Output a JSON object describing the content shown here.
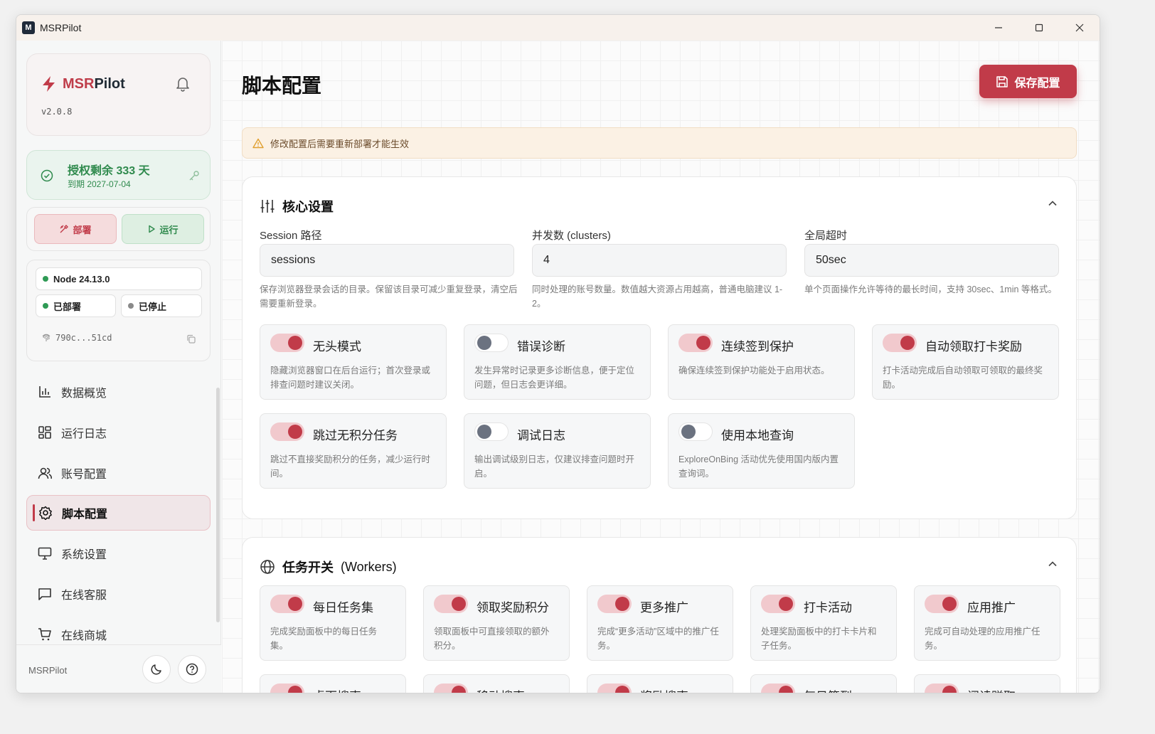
{
  "window": {
    "title": "MSRPilot"
  },
  "sidebar": {
    "brand": {
      "name_prefix": "MSR",
      "name_suffix": "Pilot",
      "version": "v2.0.8"
    },
    "license": {
      "title": "授权剩余 333 天",
      "expiry": "到期 2027-07-04"
    },
    "actions": {
      "deploy": "部署",
      "run": "运行"
    },
    "env": {
      "node": "Node 24.13.0",
      "deployed": "已部署",
      "stopped": "已停止",
      "hash": "790c...51cd"
    },
    "nav": [
      {
        "label": "数据概览",
        "icon": "bar-chart-icon"
      },
      {
        "label": "运行日志",
        "icon": "grid-icon"
      },
      {
        "label": "账号配置",
        "icon": "users-icon"
      },
      {
        "label": "脚本配置",
        "icon": "gear-icon",
        "active": true
      },
      {
        "label": "系统设置",
        "icon": "monitor-icon"
      },
      {
        "label": "在线客服",
        "icon": "chat-icon"
      },
      {
        "label": "在线商城",
        "icon": "cart-icon"
      }
    ],
    "footer": {
      "name": "MSRPilot"
    }
  },
  "main": {
    "title": "脚本配置",
    "save_label": "保存配置",
    "alert": "修改配置后需要重新部署才能生效",
    "core": {
      "title": "核心设置",
      "fields": [
        {
          "label": "Session 路径",
          "value": "sessions",
          "help": "保存浏览器登录会话的目录。保留该目录可减少重复登录，清空后需要重新登录。"
        },
        {
          "label": "并发数 (clusters)",
          "value": "4",
          "help": "同时处理的账号数量。数值越大资源占用越高，普通电脑建议 1-2。"
        },
        {
          "label": "全局超时",
          "value": "50sec",
          "help": "单个页面操作允许等待的最长时间，支持 30sec、1min 等格式。"
        }
      ],
      "toggles": [
        {
          "label": "无头模式",
          "desc": "隐藏浏览器窗口在后台运行；首次登录或排查问题时建议关闭。",
          "on": true
        },
        {
          "label": "错误诊断",
          "desc": "发生异常时记录更多诊断信息，便于定位问题，但日志会更详细。",
          "on": false
        },
        {
          "label": "连续签到保护",
          "desc": "确保连续签到保护功能处于启用状态。",
          "on": true
        },
        {
          "label": "自动领取打卡奖励",
          "desc": "打卡活动完成后自动领取可领取的最终奖励。",
          "on": true
        },
        {
          "label": "跳过无积分任务",
          "desc": "跳过不直接奖励积分的任务，减少运行时间。",
          "on": true
        },
        {
          "label": "调试日志",
          "desc": "输出调试级别日志，仅建议排查问题时开启。",
          "on": false
        },
        {
          "label": "使用本地查询",
          "desc": "ExploreOnBing 活动优先使用国内版内置查询词。",
          "on": false
        }
      ]
    },
    "workers": {
      "title": "任务开关",
      "title_en": "(Workers)",
      "toggles": [
        {
          "label": "每日任务集",
          "desc": "完成奖励面板中的每日任务集。",
          "on": true
        },
        {
          "label": "领取奖励积分",
          "desc": "领取面板中可直接领取的额外积分。",
          "on": true
        },
        {
          "label": "更多推广",
          "desc": "完成“更多活动”区域中的推广任务。",
          "on": true
        },
        {
          "label": "打卡活动",
          "desc": "处理奖励面板中的打卡卡片和子任务。",
          "on": true
        },
        {
          "label": "应用推广",
          "desc": "完成可自动处理的应用推广任务。",
          "on": true
        },
        {
          "label": "桌面搜索",
          "desc": "",
          "on": true
        },
        {
          "label": "移动搜索",
          "desc": "",
          "on": true
        },
        {
          "label": "奖励搜索",
          "desc": "",
          "on": true
        },
        {
          "label": "每日签到",
          "desc": "",
          "on": true
        },
        {
          "label": "阅读赚取",
          "desc": "",
          "on": true
        }
      ]
    }
  },
  "colors": {
    "accent": "#c13b49",
    "success": "#2f8a4d",
    "warning": "#e0a030"
  }
}
